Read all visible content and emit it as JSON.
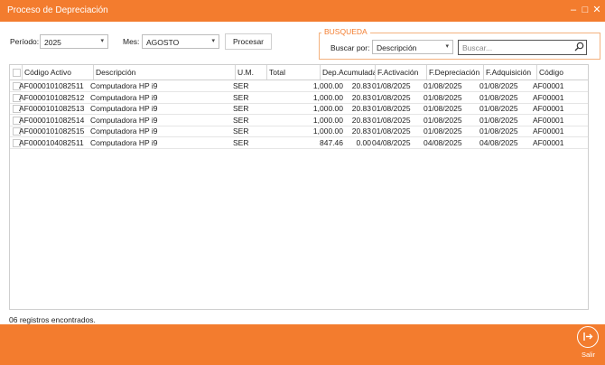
{
  "window": {
    "title": "Proceso de Depreciación",
    "accent": "#f37c2e"
  },
  "controls": {
    "periodo_label": "Período:",
    "periodo_value": "2025",
    "mes_label": "Mes:",
    "mes_value": "AGOSTO",
    "procesar_label": "Procesar"
  },
  "busqueda": {
    "title": "BUSQUEDA",
    "buscar_por_label": "Buscar por:",
    "buscar_por_value": "Descripción",
    "search_placeholder": "Buscar..."
  },
  "table": {
    "headers": [
      "Código Activo",
      "Descripción",
      "U.M.",
      "Total",
      "Dep.Acumulada",
      "F.Activación",
      "F.Depreciación",
      "F.Adquisición",
      "Código"
    ],
    "rows": [
      [
        "AF0000101082511",
        "Computadora HP i9",
        "SER",
        "1,000.00",
        "20.83",
        "01/08/2025",
        "01/08/2025",
        "01/08/2025",
        "AF00001"
      ],
      [
        "AF0000101082512",
        "Computadora HP i9",
        "SER",
        "1,000.00",
        "20.83",
        "01/08/2025",
        "01/08/2025",
        "01/08/2025",
        "AF00001"
      ],
      [
        "AF0000101082513",
        "Computadora HP i9",
        "SER",
        "1,000.00",
        "20.83",
        "01/08/2025",
        "01/08/2025",
        "01/08/2025",
        "AF00001"
      ],
      [
        "AF0000101082514",
        "Computadora HP i9",
        "SER",
        "1,000.00",
        "20.83",
        "01/08/2025",
        "01/08/2025",
        "01/08/2025",
        "AF00001"
      ],
      [
        "AF0000101082515",
        "Computadora HP i9",
        "SER",
        "1,000.00",
        "20.83",
        "01/08/2025",
        "01/08/2025",
        "01/08/2025",
        "AF00001"
      ],
      [
        "AF0000104082511",
        "Computadora HP i9",
        "SER",
        "847.46",
        "0.00",
        "04/08/2025",
        "04/08/2025",
        "04/08/2025",
        "AF00001"
      ]
    ]
  },
  "status": "06 registros encontrados.",
  "footer": {
    "exit_label": "Salir"
  }
}
